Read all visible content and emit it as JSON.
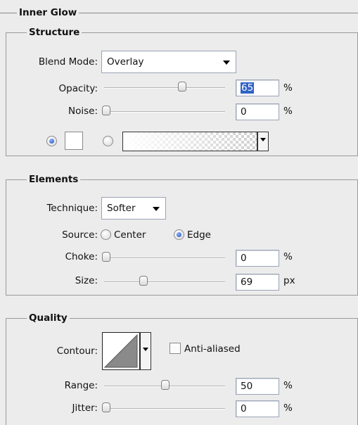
{
  "section_title": "Inner Glow",
  "structure": {
    "title": "Structure",
    "blend_mode_label": "Blend Mode:",
    "blend_mode_value": "Overlay",
    "opacity_label": "Opacity:",
    "opacity_value": "65",
    "opacity_unit": "%",
    "noise_label": "Noise:",
    "noise_value": "0",
    "noise_unit": "%"
  },
  "elements": {
    "title": "Elements",
    "technique_label": "Technique:",
    "technique_value": "Softer",
    "source_label": "Source:",
    "source_center": "Center",
    "source_edge": "Edge",
    "choke_label": "Choke:",
    "choke_value": "0",
    "choke_unit": "%",
    "size_label": "Size:",
    "size_value": "69",
    "size_unit": "px"
  },
  "quality": {
    "title": "Quality",
    "contour_label": "Contour:",
    "anti_aliased_label": "Anti-aliased",
    "range_label": "Range:",
    "range_value": "50",
    "range_unit": "%",
    "jitter_label": "Jitter:",
    "jitter_value": "0",
    "jitter_unit": "%"
  }
}
